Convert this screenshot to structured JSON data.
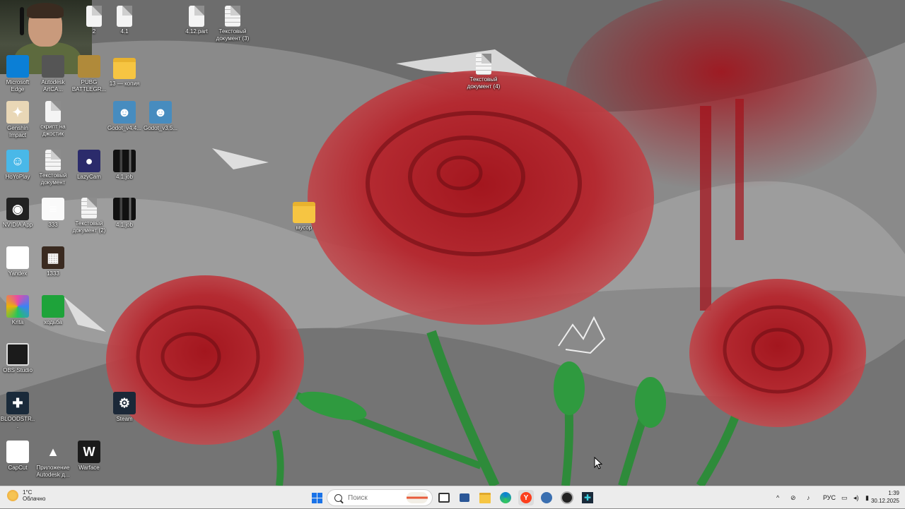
{
  "desktop_icons": {
    "c1": [
      {
        "label": "Microsoft Edge",
        "icon": "edge-icon"
      },
      {
        "label": "Genshin Impact",
        "icon": "genshin-icon"
      },
      {
        "label": "HoYoPlay",
        "icon": "hoyoplay-icon"
      },
      {
        "label": "NVIDIA App",
        "icon": "nvidia-icon"
      },
      {
        "label": "Yandex",
        "icon": "yandex-icon"
      },
      {
        "label": "Krita",
        "icon": "krita-icon"
      },
      {
        "label": "OBS Studio",
        "icon": "obs-icon"
      },
      {
        "label": "BLOODSTR...",
        "icon": "bloodstrike-icon"
      },
      {
        "label": "CapCut",
        "icon": "capcut-icon"
      }
    ],
    "c2": [
      {
        "label": "Autodesk ArtCA...",
        "icon": "autodesk-artcam-icon"
      },
      {
        "label": "скрипт на джостик",
        "icon": "text-document-icon"
      },
      {
        "label": "Текстовый документ",
        "icon": "text-document-icon"
      },
      {
        "label": "333",
        "icon": "image-file-icon"
      },
      {
        "label": "1333",
        "icon": "image-file-icon"
      },
      {
        "label": "ходьба",
        "icon": "image-file-icon"
      },
      {
        "label": "Приложение Autodesk д...",
        "icon": "autodesk-app-icon"
      }
    ],
    "c3": [
      {
        "label": "2",
        "icon": "file-icon"
      },
      {
        "label": "PUBG BATTLEGR...",
        "icon": "pubg-icon"
      },
      {
        "label": "LazyCam",
        "icon": "lazycam-icon"
      },
      {
        "label": "Текстовый документ (2)",
        "icon": "text-document-icon"
      },
      {
        "label": "Warface",
        "icon": "warface-icon"
      }
    ],
    "c4": [
      {
        "label": "4.1",
        "icon": "file-icon"
      },
      {
        "label": "13 — копия",
        "icon": "folder-icon"
      },
      {
        "label": "Godot_v4.4...",
        "icon": "godot-icon"
      },
      {
        "label": "4.1.job",
        "icon": "job-file-icon"
      },
      {
        "label": "4.1.job",
        "icon": "job-file-icon"
      },
      {
        "label": "Steam",
        "icon": "steam-icon"
      }
    ],
    "c5": [
      {
        "label": "Godot_v3.5...",
        "icon": "godot-icon"
      }
    ],
    "extra": [
      {
        "label": "4.12.part",
        "icon": "file-icon"
      },
      {
        "label": "Текстовый документ (3)",
        "icon": "text-document-icon"
      },
      {
        "label": "Текстовый документ (4)",
        "icon": "text-document-icon"
      },
      {
        "label": "мусор",
        "icon": "folder-icon"
      }
    ]
  },
  "taskbar": {
    "weather": {
      "temp": "1°C",
      "condition": "Облачно"
    },
    "search_placeholder": "Поиск",
    "language": "РУС",
    "time": "1:39",
    "date": "30.12.2025"
  },
  "colors": {
    "taskbar_bg": "#ececec",
    "start_blue": "#1a73e8"
  }
}
